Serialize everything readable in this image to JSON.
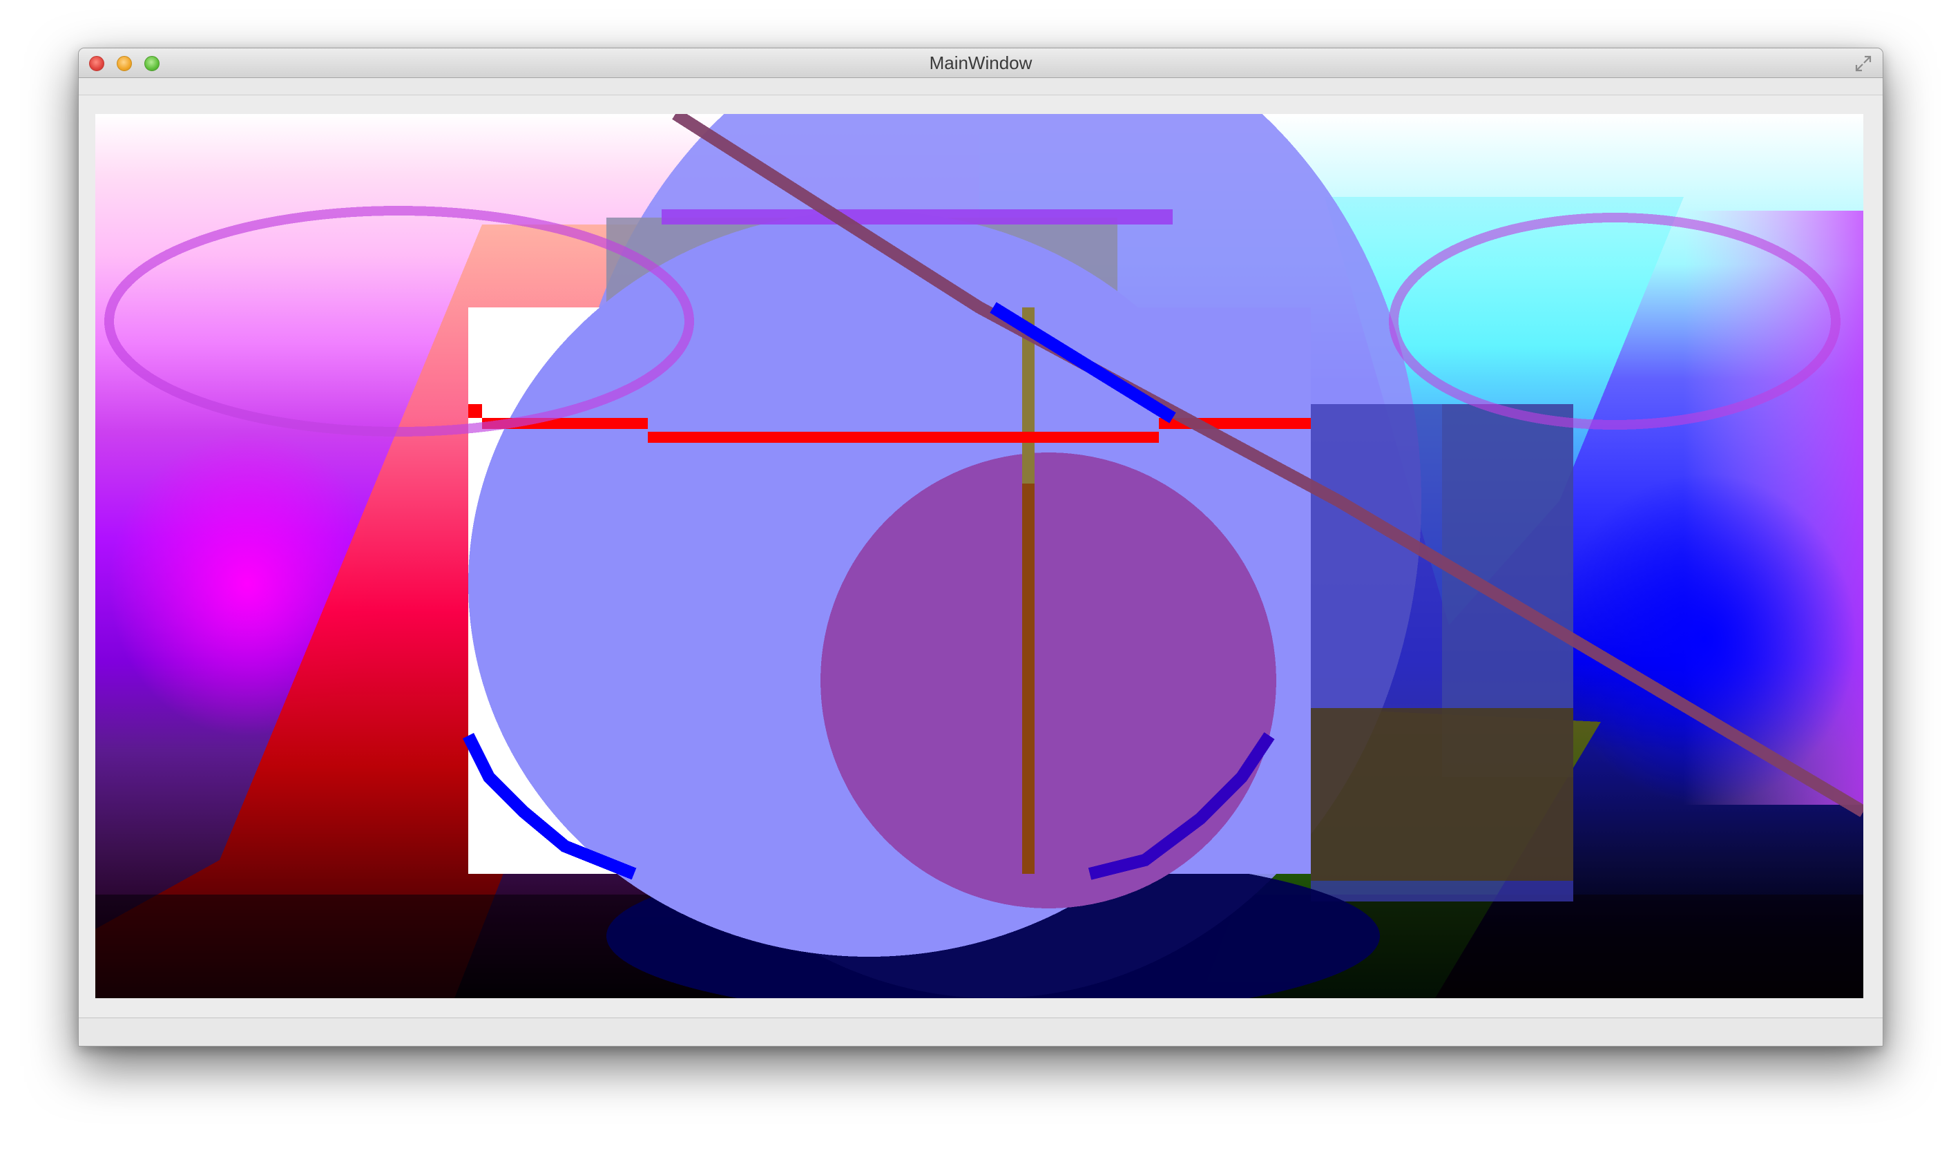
{
  "window": {
    "title": "MainWindow"
  },
  "controls": {
    "close_icon": "close-icon",
    "minimize_icon": "minimize-icon",
    "zoom_icon": "zoom-icon",
    "fullscreen_icon": "fullscreen-icon"
  },
  "colors": {
    "hatch_red": "#ff0000",
    "hatch_blue": "#0000ff",
    "lavender_ellipse": "#9090ff",
    "purple_ellipse": "#9048b0",
    "olive_bar": "#8a7a3a",
    "orange_bar": "#8a4410"
  }
}
